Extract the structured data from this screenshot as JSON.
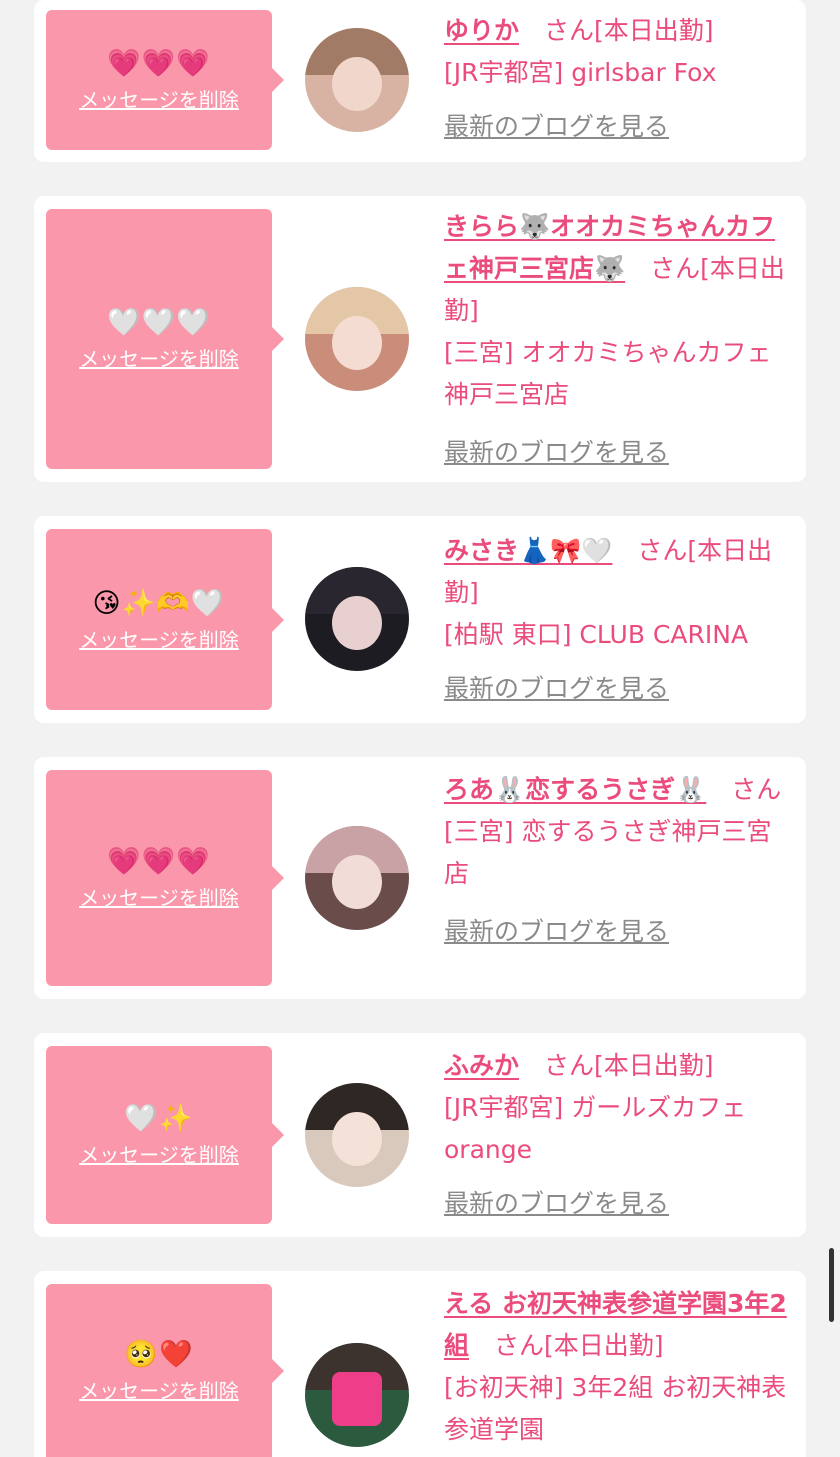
{
  "cards": [
    {
      "emojis": "💗💗💗",
      "delete_label": "メッセージを削除",
      "name": "ゆりか",
      "suffix": "　さん[本日出勤]",
      "shop": "[JR宇都宮] girlsbar Fox",
      "blog_label": "最新のブログを見る"
    },
    {
      "emojis": "🤍🤍🤍",
      "delete_label": "メッセージを削除",
      "name": "きらら🐺オオカミちゃんカフェ神戸三宮店🐺",
      "suffix": "　さん[本日出勤]",
      "shop": "[三宮] オオカミちゃんカフェ神戸三宮店",
      "blog_label": "最新のブログを見る"
    },
    {
      "emojis": "😘✨🫶🤍",
      "delete_label": "メッセージを削除",
      "name": "みさき👗🎀🤍",
      "suffix": "　さん[本日出勤]",
      "shop": "[柏駅 東口] CLUB CARINA",
      "blog_label": "最新のブログを見る"
    },
    {
      "emojis": "💗💗💗",
      "delete_label": "メッセージを削除",
      "name": "ろあ🐰恋するうさぎ🐰",
      "suffix": "　さん",
      "shop": "[三宮] 恋するうさぎ神戸三宮店",
      "blog_label": "最新のブログを見る"
    },
    {
      "emojis": "🤍✨",
      "delete_label": "メッセージを削除",
      "name": "ふみか",
      "suffix": "　さん[本日出勤]",
      "shop": "[JR宇都宮] ガールズカフェorange",
      "blog_label": "最新のブログを見る"
    },
    {
      "emojis": "🥺❤️",
      "delete_label": "メッセージを削除",
      "name": "える お初天神表参道学園3年2組",
      "suffix": "　さん[本日出勤]",
      "shop": "[お初天神] 3年2組 お初天神表参道学園",
      "blog_label": ""
    }
  ],
  "colors": {
    "accent": "#ea4c7c",
    "bubble": "#fb97aa",
    "background": "#f2f2f2"
  }
}
